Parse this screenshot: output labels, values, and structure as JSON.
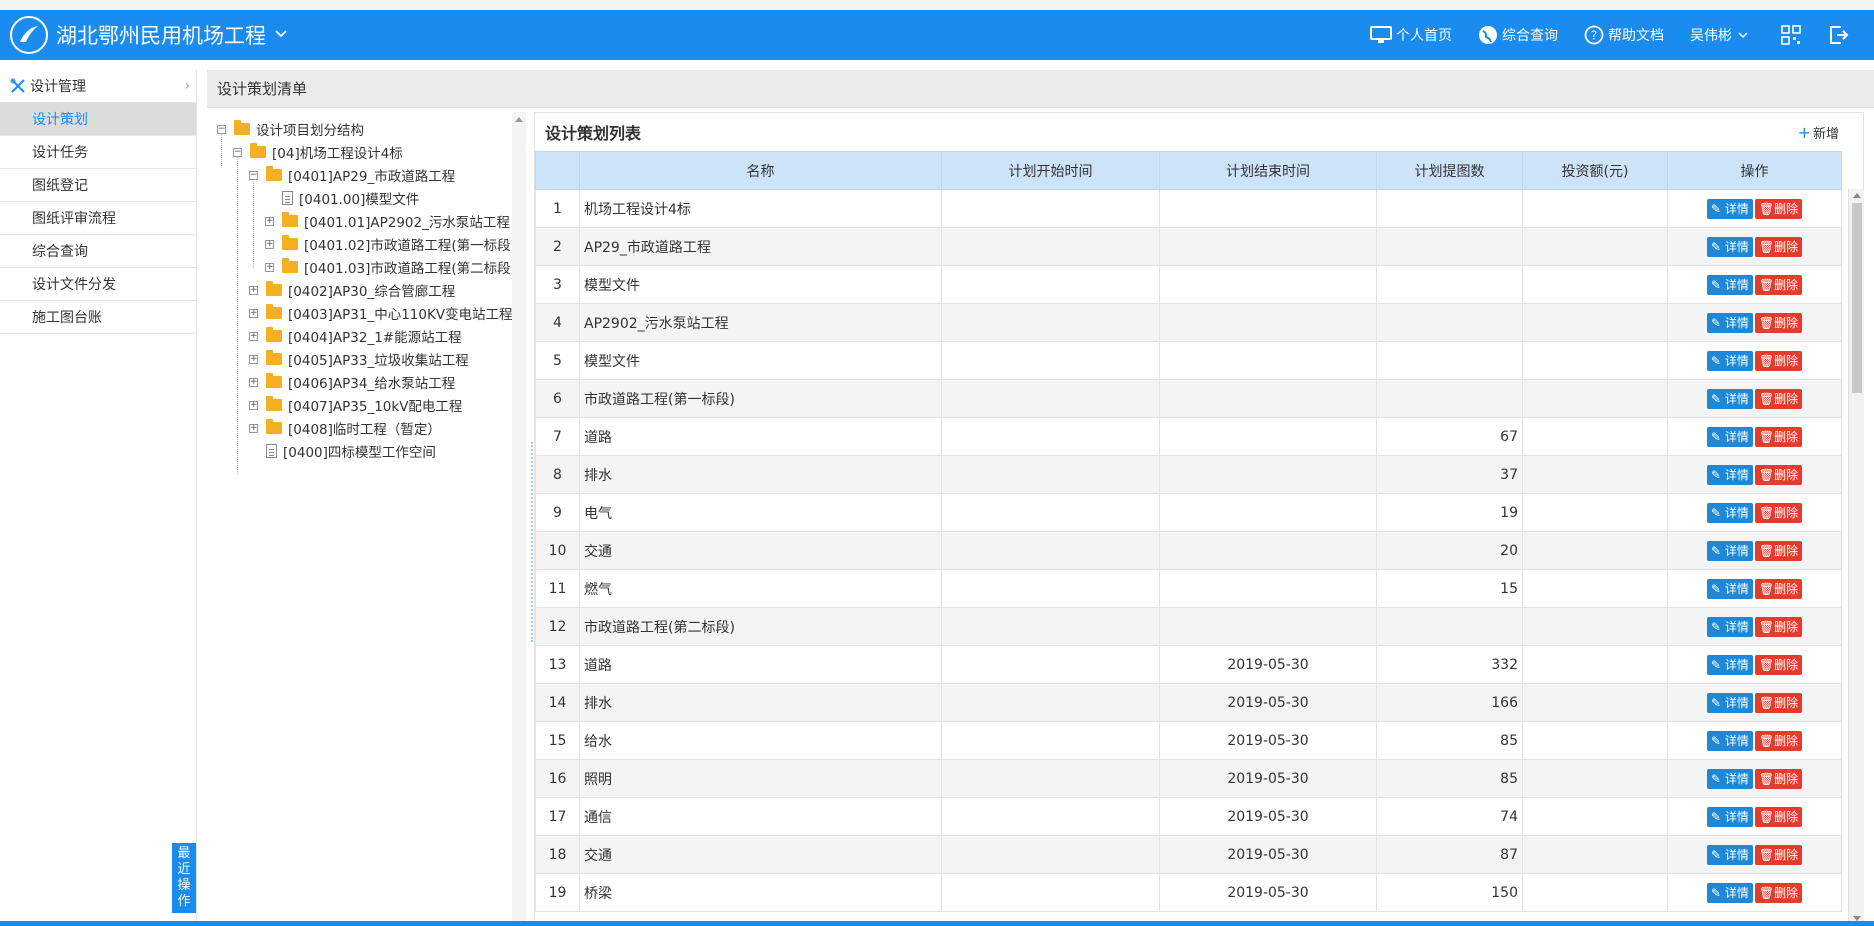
{
  "header": {
    "app_title": "湖北鄂州民用机场工程",
    "nav": {
      "home": "个人首页",
      "query": "综合查询",
      "help": "帮助文档",
      "user": "吴伟彬"
    }
  },
  "sidebar": {
    "section": "设计管理",
    "items": [
      "设计策划",
      "设计任务",
      "图纸登记",
      "图纸评审流程",
      "综合查询",
      "设计文件分发",
      "施工图台账"
    ],
    "recent": "最近操作"
  },
  "page": {
    "title": "设计策划清单"
  },
  "tree": {
    "root": "设计项目划分结构",
    "n04": "[04]机场工程设计4标",
    "n0401": "[0401]AP29_市政道路工程",
    "n040100": "[0401.00]模型文件",
    "n040101": "[0401.01]AP2902_污水泵站工程",
    "n040102": "[0401.02]市政道路工程(第一标段",
    "n040103": "[0401.03]市政道路工程(第二标段",
    "n0402": "[0402]AP30_综合管廊工程",
    "n0403": "[0403]AP31_中心110KV变电站工程",
    "n0404": "[0404]AP32_1#能源站工程",
    "n0405": "[0405]AP33_垃圾收集站工程",
    "n0406": "[0406]AP34_给水泵站工程",
    "n0407": "[0407]AP35_10kV配电工程",
    "n0408": "[0408]临时工程（暂定）",
    "n0400": "[0400]四标模型工作空间"
  },
  "list": {
    "title": "设计策划列表",
    "add_label": "新增",
    "columns": [
      "名称",
      "计划开始时间",
      "计划结束时间",
      "计划提图数",
      "投资额(元)",
      "操作"
    ],
    "detail_label": "详情",
    "delete_label": "删除",
    "rows": [
      {
        "no": "1",
        "name": "机场工程设计4标",
        "start": "",
        "end": "",
        "count": "",
        "invest": ""
      },
      {
        "no": "2",
        "name": "AP29_市政道路工程",
        "start": "",
        "end": "",
        "count": "",
        "invest": ""
      },
      {
        "no": "3",
        "name": "模型文件",
        "start": "",
        "end": "",
        "count": "",
        "invest": ""
      },
      {
        "no": "4",
        "name": "AP2902_污水泵站工程",
        "start": "",
        "end": "",
        "count": "",
        "invest": ""
      },
      {
        "no": "5",
        "name": "模型文件",
        "start": "",
        "end": "",
        "count": "",
        "invest": ""
      },
      {
        "no": "6",
        "name": "市政道路工程(第一标段)",
        "start": "",
        "end": "",
        "count": "",
        "invest": ""
      },
      {
        "no": "7",
        "name": "道路",
        "start": "",
        "end": "",
        "count": "67",
        "invest": ""
      },
      {
        "no": "8",
        "name": "排水",
        "start": "",
        "end": "",
        "count": "37",
        "invest": ""
      },
      {
        "no": "9",
        "name": "电气",
        "start": "",
        "end": "",
        "count": "19",
        "invest": ""
      },
      {
        "no": "10",
        "name": "交通",
        "start": "",
        "end": "",
        "count": "20",
        "invest": ""
      },
      {
        "no": "11",
        "name": "燃气",
        "start": "",
        "end": "",
        "count": "15",
        "invest": ""
      },
      {
        "no": "12",
        "name": "市政道路工程(第二标段)",
        "start": "",
        "end": "",
        "count": "",
        "invest": ""
      },
      {
        "no": "13",
        "name": "道路",
        "start": "",
        "end": "2019-05-30",
        "count": "332",
        "invest": ""
      },
      {
        "no": "14",
        "name": "排水",
        "start": "",
        "end": "2019-05-30",
        "count": "166",
        "invest": ""
      },
      {
        "no": "15",
        "name": "给水",
        "start": "",
        "end": "2019-05-30",
        "count": "85",
        "invest": ""
      },
      {
        "no": "16",
        "name": "照明",
        "start": "",
        "end": "2019-05-30",
        "count": "85",
        "invest": ""
      },
      {
        "no": "17",
        "name": "通信",
        "start": "",
        "end": "2019-05-30",
        "count": "74",
        "invest": ""
      },
      {
        "no": "18",
        "name": "交通",
        "start": "",
        "end": "2019-05-30",
        "count": "87",
        "invest": ""
      },
      {
        "no": "19",
        "name": "桥梁",
        "start": "",
        "end": "2019-05-30",
        "count": "150",
        "invest": ""
      }
    ]
  },
  "colors": {
    "primary": "#1a8cf0",
    "danger": "#e23c2c",
    "header_row": "#cde3f8"
  }
}
